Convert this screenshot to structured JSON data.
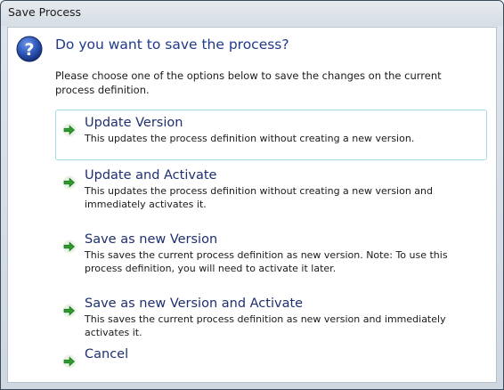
{
  "window": {
    "title": "Save Process"
  },
  "dialog": {
    "heading": "Do you want to save the process?",
    "intro": "Please choose one of the options below to save the changes on the current process definition."
  },
  "options": [
    {
      "title": "Update Version",
      "description": "This updates the process definition without creating a new version."
    },
    {
      "title": "Update and Activate",
      "description": "This updates the process definition without creating a new version and immediately activates it."
    },
    {
      "title": "Save as new Version",
      "description": "This saves the current process definition as new version. Note: To use this process definition, you will need to activate it later."
    },
    {
      "title": "Save as new Version and Activate",
      "description": "This saves the current process definition as new version and immediately activates it."
    },
    {
      "title": "Cancel",
      "description": ""
    }
  ],
  "colors": {
    "heading": "#1f3a8a",
    "option_title": "#1f2f70",
    "arrow": "#2e9a2e",
    "selected_border": "#a9dbe8"
  },
  "icons": {
    "header": "question-icon",
    "option": "green-arrow-icon"
  }
}
